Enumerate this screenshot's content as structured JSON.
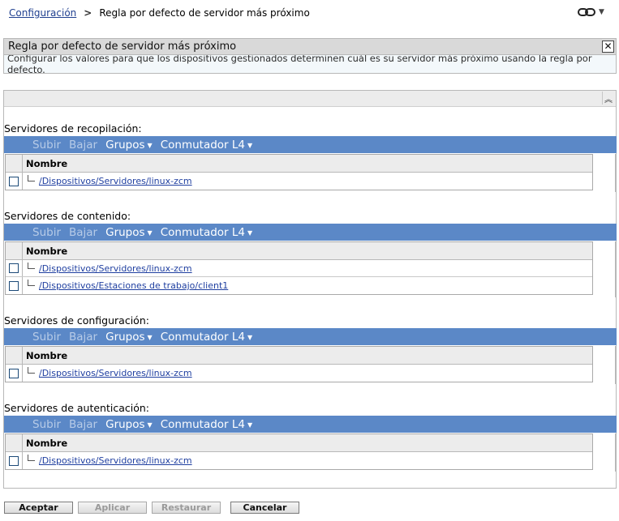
{
  "breadcrumb": {
    "parent": "Configuración",
    "current": "Regla por defecto de servidor más próximo"
  },
  "icons": [
    "link-icon",
    "dropdown-arrow-icon",
    "close-icon",
    "collapse-up-icon"
  ],
  "info": {
    "title": "Regla por defecto de servidor más próximo",
    "description": "Configurar los valores para que los dispositivos gestionados determinen cuál es su servidor más próximo usando la regla por defecto."
  },
  "toolbar": {
    "up": "Subir",
    "down": "Bajar",
    "groups": "Grupos",
    "l4": "Conmutador L4"
  },
  "grid_header": "Nombre",
  "sections": [
    {
      "label": "Servidores de recopilación:",
      "rows": [
        "/Dispositivos/Servidores/linux-zcm"
      ]
    },
    {
      "label": "Servidores de contenido:",
      "rows": [
        "/Dispositivos/Servidores/linux-zcm",
        "/Dispositivos/Estaciones de trabajo/client1"
      ]
    },
    {
      "label": "Servidores de configuración:",
      "rows": [
        "/Dispositivos/Servidores/linux-zcm"
      ]
    },
    {
      "label": "Servidores de autenticación:",
      "rows": [
        "/Dispositivos/Servidores/linux-zcm"
      ]
    }
  ],
  "buttons": {
    "accept": "Aceptar",
    "apply": "Aplicar",
    "restore": "Restaurar",
    "cancel": "Cancelar"
  },
  "colors": {
    "toolbar_bg": "#5b88c7",
    "link": "#1f3fa0"
  }
}
